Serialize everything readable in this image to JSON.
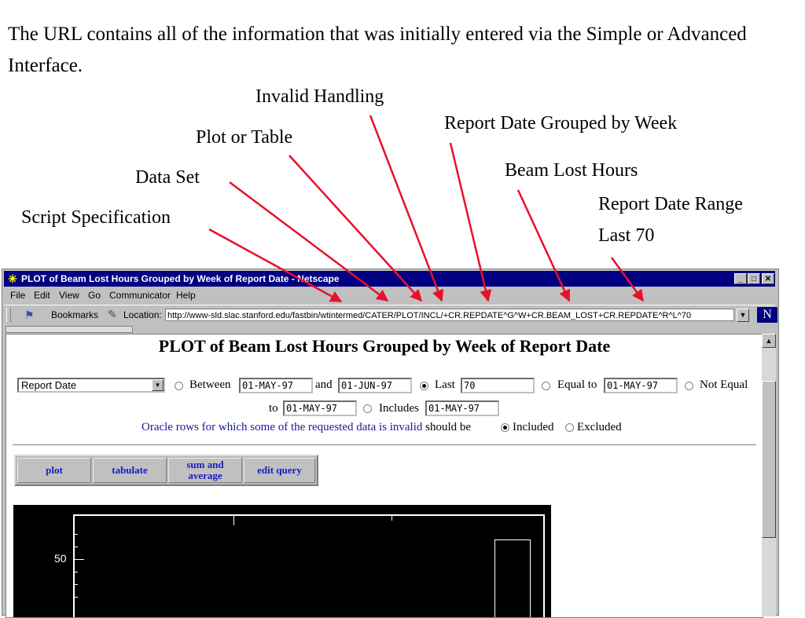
{
  "slide": {
    "intro": "The URL contains all of the information that was initially entered via the Simple or Advanced Interface.",
    "labels": {
      "invalid": "Invalid Handling",
      "repweek": "Report Date Grouped by Week",
      "plottable": "Plot or Table",
      "beamlost": "Beam Lost Hours",
      "dataset": "Data Set",
      "range": "Report Date Range",
      "last70": "Last 70",
      "script": "Script Specification"
    },
    "arrow_color": "#e8102a"
  },
  "browser": {
    "title": "PLOT of Beam Lost Hours Grouped by Week of Report Date - Netscape",
    "menu": [
      "File",
      "Edit",
      "View",
      "Go",
      "Communicator",
      "Help"
    ],
    "bookmarks": "Bookmarks",
    "location_label": "Location:",
    "url": "http://www-sld.slac.stanford.edu/fastbin/wtintermed/CATER/PLOT/INCL/+CR.REPDATE^G^W+CR.BEAM_LOST+CR.REPDATE^R^L^70",
    "logo": "N"
  },
  "page": {
    "heading": "PLOT of Beam Lost Hours Grouped by Week of Report Date",
    "field_select": "Report Date",
    "between": "Between",
    "between_from": "01-MAY-97",
    "and": "and",
    "between_to": "01-JUN-97",
    "last": "Last",
    "last_value": "70",
    "equal_to": "Equal to",
    "equal_value": "01-MAY-97",
    "not_equal": "Not Equal",
    "to": "to",
    "not_equal_value": "01-MAY-97",
    "includes": "Includes",
    "includes_value": "01-MAY-97",
    "invalid_text": "Oracle rows for which some of the requested data is invalid",
    "should_be": "should be",
    "included": "Included",
    "excluded": "Excluded",
    "buttons": {
      "plot": "plot",
      "tabulate": "tabulate",
      "sum_line1": "sum and",
      "sum_line2": "average",
      "edit": "edit query"
    },
    "plot_tick": "50"
  }
}
